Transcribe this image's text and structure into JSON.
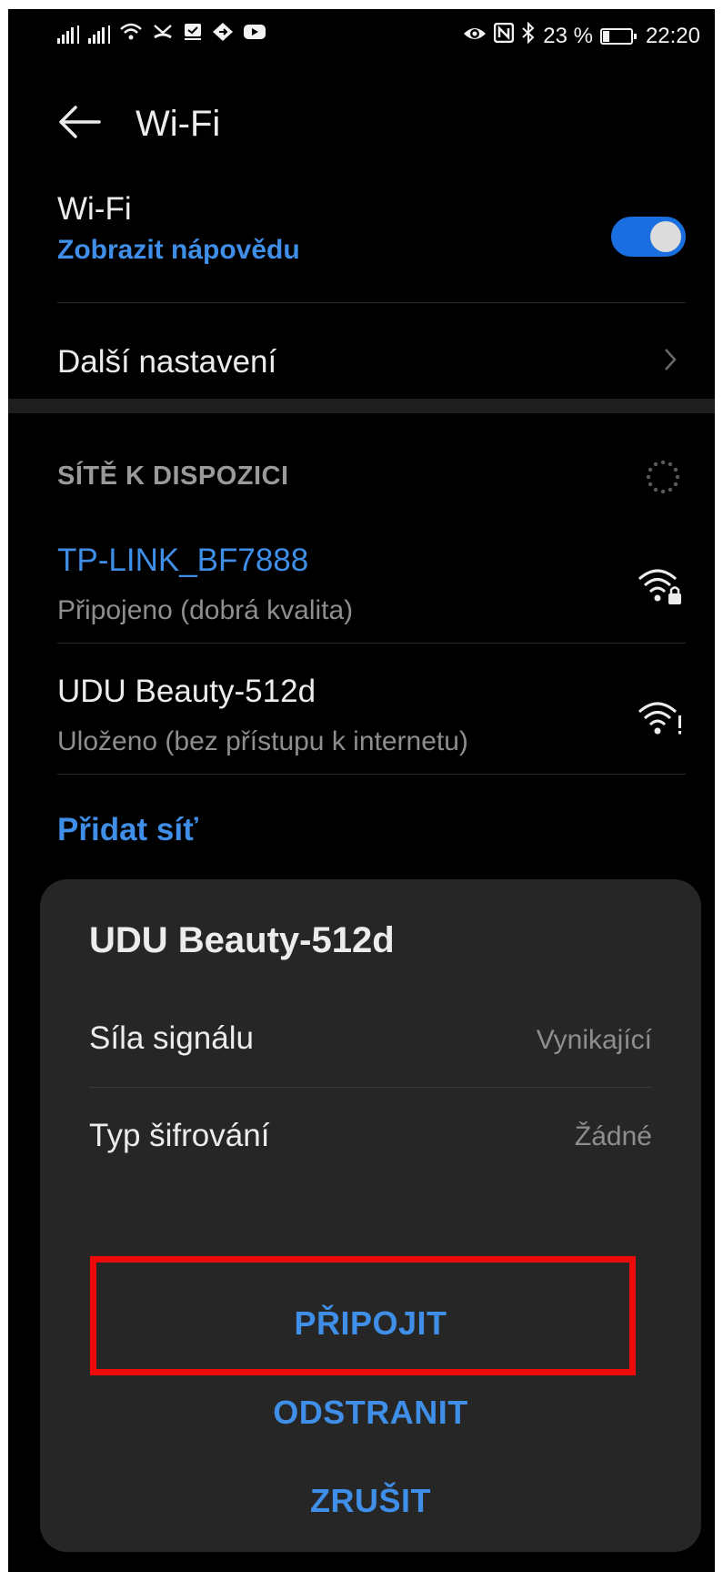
{
  "status_bar": {
    "battery_text": "23 %",
    "time": "22:20",
    "battery_level": 0.23
  },
  "header": {
    "title": "Wi-Fi"
  },
  "wifi_setting": {
    "label": "Wi-Fi",
    "help_link": "Zobrazit nápovědu",
    "enabled": true,
    "toggle_color": "#1a6fe0"
  },
  "more_settings": {
    "label": "Další nastavení"
  },
  "networks": {
    "section_title": "SÍTĚ K DISPOZICI",
    "items": [
      {
        "name": "TP-LINK_BF7888",
        "status": "Připojeno (dobrá kvalita)",
        "icon": "wifi-lock-icon",
        "connected": true
      },
      {
        "name": "UDU Beauty-512d",
        "status": "Uloženo (bez přístupu k internetu)",
        "icon": "wifi-alert-icon",
        "connected": false
      }
    ],
    "add_network": "Přidat síť"
  },
  "dialog": {
    "title": "UDU Beauty-512d",
    "rows": [
      {
        "label": "Síla signálu",
        "value": "Vynikající"
      },
      {
        "label": "Typ šifrování",
        "value": "Žádné"
      }
    ],
    "buttons": {
      "connect": "PŘIPOJIT",
      "remove": "ODSTRANIT",
      "cancel": "ZRUŠIT"
    }
  },
  "colors": {
    "accent": "#3f8ee8",
    "highlight": "#ee0a0a",
    "background": "#000000",
    "dialog_bg": "#262626"
  }
}
